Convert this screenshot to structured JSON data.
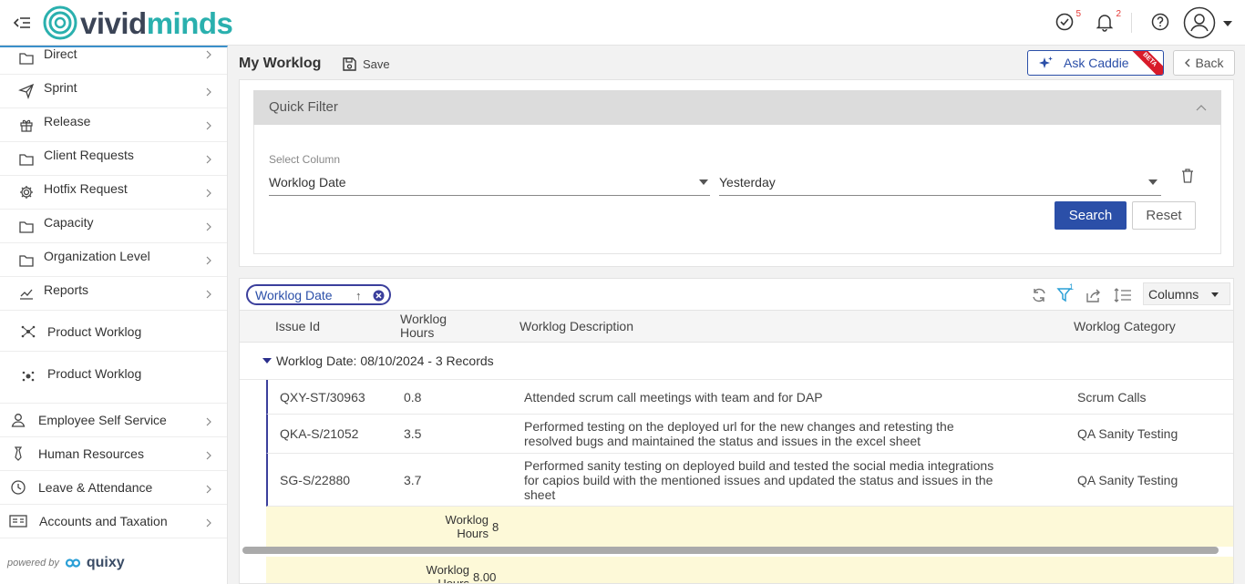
{
  "brand": {
    "logo_part1": "vivid",
    "logo_part2": "minds"
  },
  "header": {
    "tasks_badge": "5",
    "notifications_badge": "2"
  },
  "sidebar": {
    "items": [
      {
        "label": "Direct",
        "icon": "folder-icon"
      },
      {
        "label": "Sprint",
        "icon": "paper-plane-icon"
      },
      {
        "label": "Release",
        "icon": "gift-icon"
      },
      {
        "label": "Client Requests",
        "icon": "folder-icon"
      },
      {
        "label": "Hotfix Request",
        "icon": "gear-icon"
      },
      {
        "label": "Capacity",
        "icon": "folder-icon"
      },
      {
        "label": "Organization Level",
        "icon": "folder-icon"
      },
      {
        "label": "Reports",
        "icon": "chart-icon"
      },
      {
        "label": "Product Worklog",
        "icon": "network-icon"
      },
      {
        "label": "Product Worklog",
        "icon": "network-icon"
      },
      {
        "label": "Employee Self Service",
        "icon": "user-icon"
      },
      {
        "label": "Human Resources",
        "icon": "tie-icon"
      },
      {
        "label": "Leave & Attendance",
        "icon": "clock-icon"
      },
      {
        "label": "Accounts and Taxation",
        "icon": "id-card-icon"
      }
    ],
    "powered_by": "powered by",
    "powered_brand": "quixy"
  },
  "page": {
    "title": "My Worklog",
    "save_label": "Save",
    "ask_caddie": "Ask Caddie",
    "beta_label": "BETA",
    "back_label": "Back"
  },
  "filter": {
    "title": "Quick Filter",
    "select_column_caption": "Select Column",
    "column_value": "Worklog Date",
    "condition_value": "Yesterday",
    "search_label": "Search",
    "reset_label": "Reset"
  },
  "grid": {
    "group_chip": "Worklog Date",
    "group_chip_arrow": "↑",
    "columns_label": "Columns",
    "filter_badge": "1",
    "headers": {
      "issue_id": "Issue Id",
      "hours_line1": "Worklog",
      "hours_line2": "Hours",
      "description": "Worklog Description",
      "category": "Worklog Category"
    },
    "group_label": "Worklog Date: 08/10/2024 - 3 Records",
    "rows": [
      {
        "id": "QXY-ST/30963",
        "hours": "0.8",
        "desc_lines": [
          "Attended scrum call meetings with team and for DAP"
        ],
        "category": "Scrum Calls"
      },
      {
        "id": "QKA-S/21052",
        "hours": "3.5",
        "desc_lines": [
          "Performed testing on the deployed url for the new changes and retesting the",
          "resolved bugs and maintained the status and issues in the excel sheet"
        ],
        "category": "QA Sanity Testing"
      },
      {
        "id": "SG-S/22880",
        "hours": "3.7",
        "desc_lines": [
          "Performed sanity testing on deployed build and tested the social media integrations",
          "for capios build with the mentioned issues and updated the status and issues in the",
          "sheet"
        ],
        "category": "QA Sanity Testing"
      }
    ],
    "summary1": {
      "label_line1": "Worklog",
      "label_line2": "Hours",
      "value": "8"
    },
    "summary2": {
      "label_line1": "Worklog",
      "label_line2": "Hours",
      "value": "8.00"
    }
  }
}
